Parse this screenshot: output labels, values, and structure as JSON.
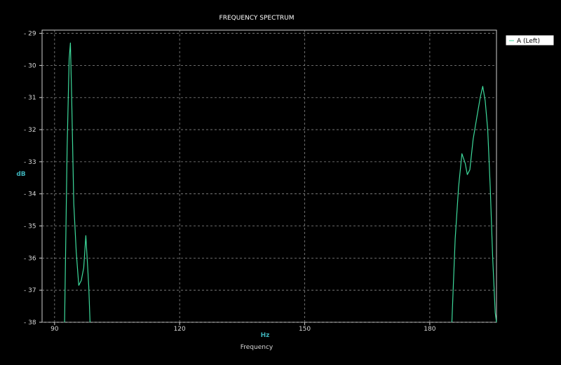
{
  "chart_data": {
    "type": "line",
    "title": "FREQUENCY SPECTRUM",
    "xlabel": "Frequency",
    "x_unit": "Hz",
    "ylabel": "dB",
    "xlim": [
      87,
      196
    ],
    "ylim": [
      -38,
      -28.9
    ],
    "x_ticks": [
      90,
      120,
      150,
      180
    ],
    "y_ticks": [
      -29,
      -30,
      -31,
      -32,
      -33,
      -34,
      -35,
      -36,
      -37,
      -38
    ],
    "grid": true,
    "legend_position": "top-right",
    "series": [
      {
        "name": "A (Left)",
        "color": "#3dd99b",
        "segments": [
          [
            [
              92.4,
              -38
            ],
            [
              93.0,
              -32.6
            ],
            [
              93.5,
              -29.8
            ],
            [
              93.8,
              -29.3
            ],
            [
              94.1,
              -31.0
            ],
            [
              94.6,
              -34.3
            ],
            [
              95.2,
              -35.8
            ],
            [
              95.8,
              -36.85
            ],
            [
              96.4,
              -36.7
            ],
            [
              97.0,
              -36.3
            ],
            [
              97.5,
              -35.3
            ],
            [
              97.9,
              -36.2
            ],
            [
              98.2,
              -36.9
            ],
            [
              98.5,
              -38
            ]
          ],
          [
            [
              185.3,
              -38
            ],
            [
              186.1,
              -35.4
            ],
            [
              186.9,
              -33.8
            ],
            [
              187.7,
              -32.75
            ],
            [
              188.5,
              -33.05
            ],
            [
              189.0,
              -33.4
            ],
            [
              189.6,
              -33.25
            ],
            [
              190.4,
              -32.3
            ],
            [
              191.3,
              -31.6
            ],
            [
              192.1,
              -31.0
            ],
            [
              192.7,
              -30.65
            ],
            [
              193.3,
              -31.1
            ],
            [
              193.9,
              -32.0
            ],
            [
              194.5,
              -33.8
            ],
            [
              195.1,
              -36.0
            ],
            [
              195.7,
              -37.7
            ],
            [
              196.0,
              -38
            ]
          ]
        ]
      }
    ]
  }
}
